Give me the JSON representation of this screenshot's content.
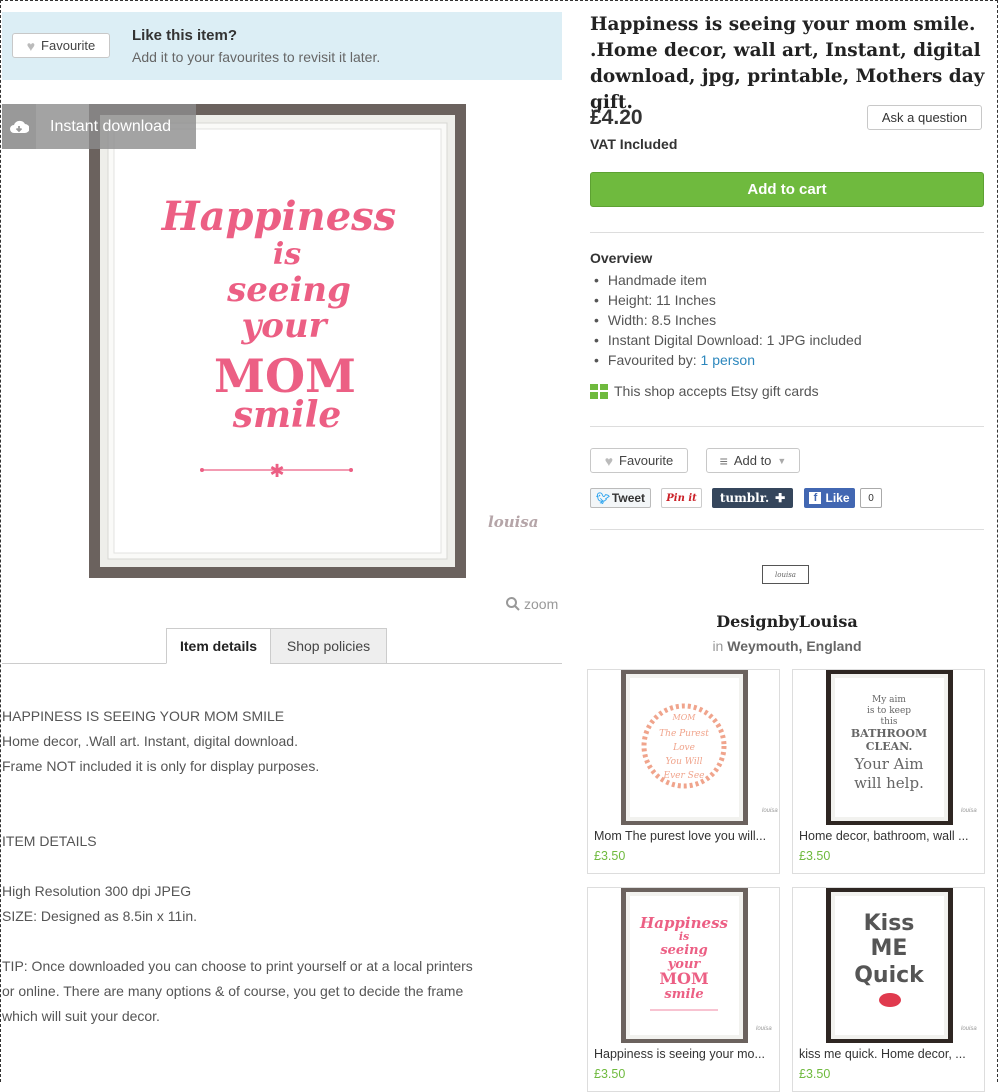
{
  "favourite_banner": {
    "button_label": "Favourite",
    "title": "Like this item?",
    "subtitle": "Add it to your favourites to revisit it later."
  },
  "main_image": {
    "badge": "Instant download",
    "art_lines": [
      "Happiness",
      "is",
      "seeing",
      "your",
      "MOM",
      "smile"
    ],
    "signature": "louisa",
    "zoom_label": "zoom"
  },
  "tabs": [
    "Item details",
    "Shop policies"
  ],
  "description": [
    "HAPPINESS IS SEEING YOUR MOM SMILE",
    "Home decor, .Wall art. Instant, digital download.",
    "Frame NOT included it is only for display purposes.",
    "",
    "",
    "ITEM DETAILS",
    "",
    "High Resolution 300 dpi JPEG",
    "SIZE: Designed as 8.5in x 11in.",
    "",
    "TIP: Once downloaded you can choose to print yourself or at a local printers",
    "or online. There are many options & of course, you get to decide the frame",
    "which will suit your decor."
  ],
  "listing": {
    "title": "Happiness is seeing your mom smile. .Home decor, wall art, Instant, digital download, jpg, printable, Mothers day gift.",
    "price": "£4.20",
    "vat": "VAT Included",
    "ask_question": "Ask a question",
    "add_to_cart": "Add to cart",
    "overview_heading": "Overview",
    "overview": {
      "handmade": "Handmade item",
      "height": "Height: 11 Inches",
      "width": "Width: 8.5 Inches",
      "download": "Instant Digital Download: 1 JPG included",
      "favourited_prefix": "Favourited by:",
      "favourited_link": "1 person"
    },
    "gift_cards": "This shop accepts Etsy gift cards",
    "favourite_button": "Favourite",
    "add_to_button": "Add to"
  },
  "social": {
    "tweet": "Tweet",
    "pinit": "Pin it",
    "tumblr": "tumblr.",
    "like": "Like",
    "like_count": "0"
  },
  "shop": {
    "logo_text": "louisa",
    "name": "DesignbyLouisa",
    "location_prefix": "in",
    "location": "Weymouth, England"
  },
  "related": [
    {
      "caption": "Mom The purest love you will...",
      "price": "£3.50",
      "art": [
        "MOM",
        "The Purest",
        "Love",
        "You Will",
        "Ever See"
      ]
    },
    {
      "caption": "Home decor, bathroom, wall ...",
      "price": "£3.50",
      "art": [
        "My aim",
        "is to keep",
        "this",
        "BATHROOM",
        "CLEAN.",
        "Your Aim",
        "will help."
      ]
    },
    {
      "caption": "Happiness is seeing your mo...",
      "price": "£3.50",
      "art": [
        "Happiness",
        "is",
        "seeing",
        "your",
        "MOM",
        "smile"
      ]
    },
    {
      "caption": "kiss me quick. Home decor, ...",
      "price": "£3.50",
      "art": [
        "Kiss",
        "ME",
        "Quick"
      ]
    }
  ],
  "colors": {
    "accent_green": "#6fba3e",
    "pink": "#ec5f84",
    "banner_bg": "#dceef5",
    "link_blue": "#2c87bd"
  }
}
